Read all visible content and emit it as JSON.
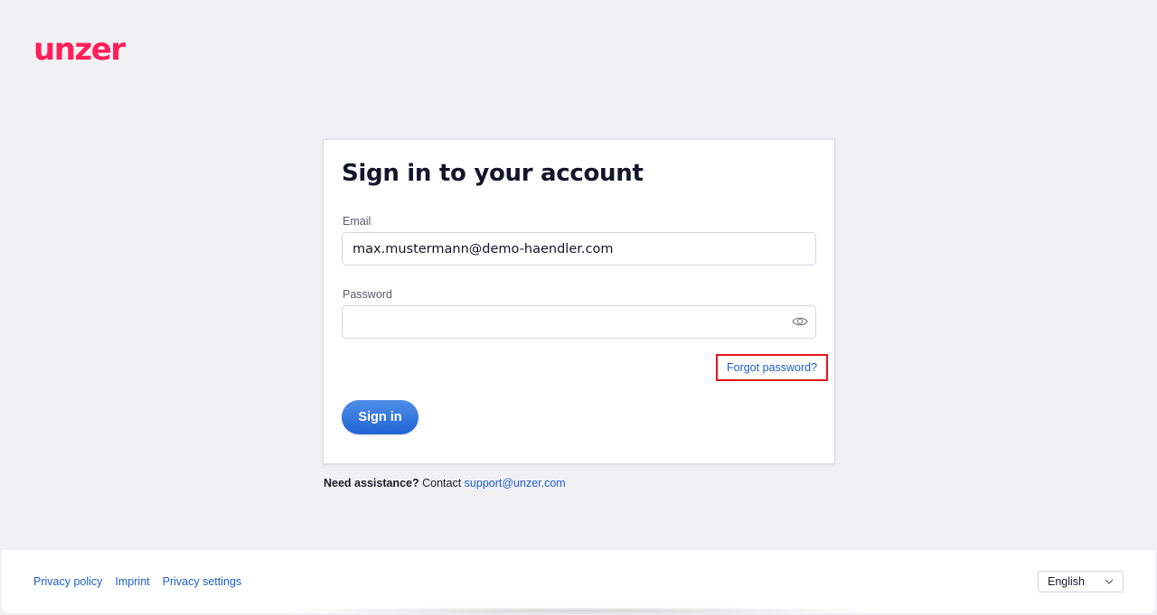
{
  "brand": {
    "logo_text": "unzer",
    "logo_color": "#ff1f5a"
  },
  "signin_card": {
    "title": "Sign in to your account",
    "email_label": "Email",
    "email_value": "max.mustermann@demo-haendler.com",
    "password_label": "Password",
    "password_value": "",
    "forgot_password": "Forgot password?",
    "signin_button": "Sign in"
  },
  "assistance": {
    "bold_text": "Need assistance?",
    "contact_text": "Contact",
    "email_link": "support@unzer.com"
  },
  "footer": {
    "links": [
      "Privacy policy",
      "Imprint",
      "Privacy settings"
    ],
    "language": "English"
  },
  "colors": {
    "accent": "#1f63d4",
    "link": "#1e5fc8",
    "highlight": "#e8141c"
  },
  "icons": [
    "eye-icon",
    "chevron-down-icon"
  ]
}
